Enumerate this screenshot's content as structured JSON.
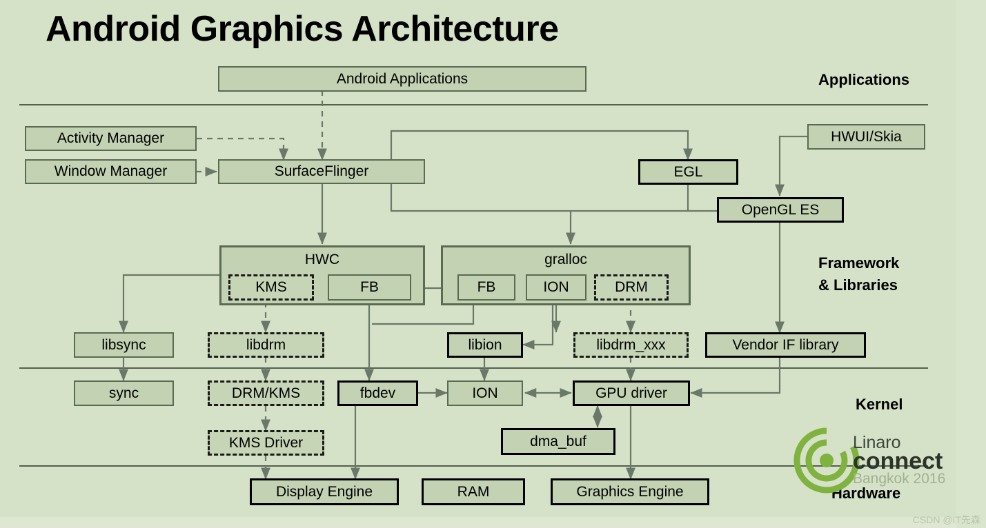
{
  "slide": {
    "title": "Android Graphics Architecture",
    "background_color": "#d6e2c7",
    "box_fill_color": "#c3d2b2",
    "box_border_color": "#5a6b52",
    "accent_color": "#6fa83a"
  },
  "layer_labels": [
    {
      "id": "applications",
      "text": "Applications"
    },
    {
      "id": "framework",
      "text": "Framework\n& Libraries"
    },
    {
      "id": "kernel",
      "text": "Kernel"
    },
    {
      "id": "hardware",
      "text": "Hardware"
    }
  ],
  "nodes": [
    {
      "id": "android_applications",
      "label": "Android Applications"
    },
    {
      "id": "activity_manager",
      "label": "Activity Manager"
    },
    {
      "id": "window_manager",
      "label": "Window Manager"
    },
    {
      "id": "surfaceflinger",
      "label": "SurfaceFlinger"
    },
    {
      "id": "egl",
      "label": "EGL"
    },
    {
      "id": "hwui_skia",
      "label": "HWUI/Skia"
    },
    {
      "id": "opengl_es",
      "label": "OpenGL ES"
    },
    {
      "id": "hwc",
      "label": "HWC"
    },
    {
      "id": "hwc_kms",
      "label": "KMS"
    },
    {
      "id": "hwc_fb",
      "label": "FB"
    },
    {
      "id": "gralloc",
      "label": "gralloc"
    },
    {
      "id": "gralloc_fb",
      "label": "FB"
    },
    {
      "id": "gralloc_ion",
      "label": "ION"
    },
    {
      "id": "gralloc_drm",
      "label": "DRM"
    },
    {
      "id": "libsync",
      "label": "libsync"
    },
    {
      "id": "libdrm",
      "label": "libdrm"
    },
    {
      "id": "libion",
      "label": "libion"
    },
    {
      "id": "libdrm_xxx",
      "label": "libdrm_xxx"
    },
    {
      "id": "vendor_if_library",
      "label": "Vendor IF library"
    },
    {
      "id": "sync",
      "label": "sync"
    },
    {
      "id": "drm_kms",
      "label": "DRM/KMS"
    },
    {
      "id": "fbdev",
      "label": "fbdev"
    },
    {
      "id": "ion",
      "label": "ION"
    },
    {
      "id": "gpu_driver",
      "label": "GPU driver"
    },
    {
      "id": "kms_driver",
      "label": "KMS Driver"
    },
    {
      "id": "dma_buf",
      "label": "dma_buf"
    },
    {
      "id": "display_engine",
      "label": "Display Engine"
    },
    {
      "id": "ram",
      "label": "RAM"
    },
    {
      "id": "graphics_engine",
      "label": "Graphics Engine"
    }
  ],
  "branding": {
    "line1": "Linaro",
    "line2": "connect",
    "line3": "Bangkok 2016"
  },
  "watermark": "CSDN @IT先森"
}
